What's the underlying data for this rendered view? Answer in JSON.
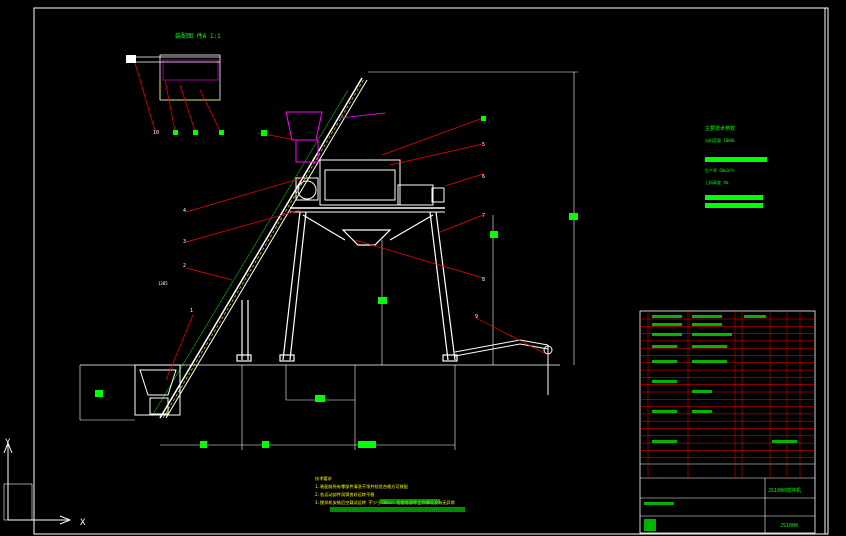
{
  "drawing": {
    "detail_title": "装配图 件A 1:1",
    "leader_numbers": [
      "1",
      "2",
      "3",
      "4",
      "5",
      "6",
      "7",
      "8",
      "9",
      "10",
      "11",
      "12",
      "13",
      "14"
    ],
    "dim_labels": [
      "1385",
      "700",
      "1200",
      "2500",
      "4800",
      "1480",
      "5300",
      "3600"
    ],
    "notes_title": "技术要求",
    "notes": [
      "1.装配前所有零部件清洗干净并检验合格方可装配",
      "2.各运动部件润滑良好运转平稳",
      "3.搅拌机安装后空载试运转 不少于30min 检查各部件工作情况及有无异常"
    ],
    "spec_title": "主要技术参数",
    "spec_lines": [
      "出料容量 1000L",
      "生产率 60m3/h",
      "上料高度 4m"
    ],
    "title_block": {
      "name": "JS1000搅拌机",
      "code": "JS1000"
    },
    "axis": {
      "x": "X",
      "y": "Y"
    }
  },
  "colors": {
    "background": "#000000",
    "frame": "#ffffff",
    "leader": "#ff0000",
    "dimension": "#00ff00",
    "machine": "#ffffff",
    "accent": "#ff00ff",
    "guide": "#ffff00",
    "table_line": "#ff0000"
  }
}
